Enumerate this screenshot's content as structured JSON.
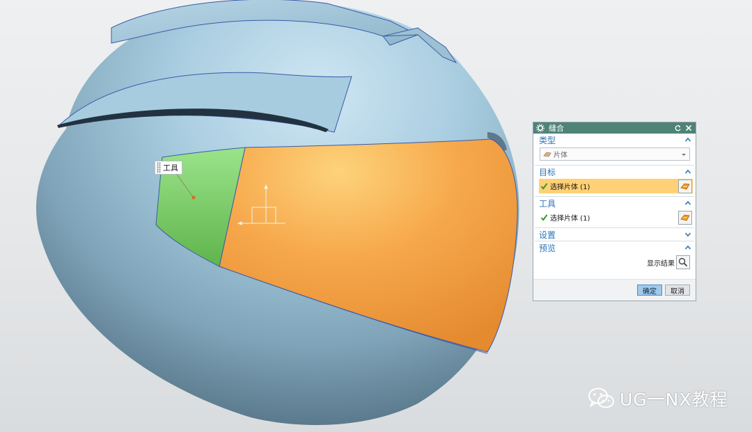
{
  "viewport": {
    "tool_label": "工具",
    "colors": {
      "helmet": "#9ec3d8",
      "tool_sheet": "#7fcf6a",
      "target_sheet": "#f39a3c"
    }
  },
  "dialog": {
    "title": "缝合",
    "sections": {
      "type": {
        "label": "类型",
        "value": "片体"
      },
      "target": {
        "label": "目标",
        "row_text": "选择片体 (1)"
      },
      "tool": {
        "label": "工具",
        "row_text": "选择片体 (1)"
      },
      "settings": {
        "label": "设置"
      },
      "preview": {
        "label": "预览",
        "show_result": "显示结果"
      }
    },
    "buttons": {
      "ok": "确定",
      "cancel": "取消"
    }
  },
  "watermark": {
    "text": "UG一NX教程"
  }
}
